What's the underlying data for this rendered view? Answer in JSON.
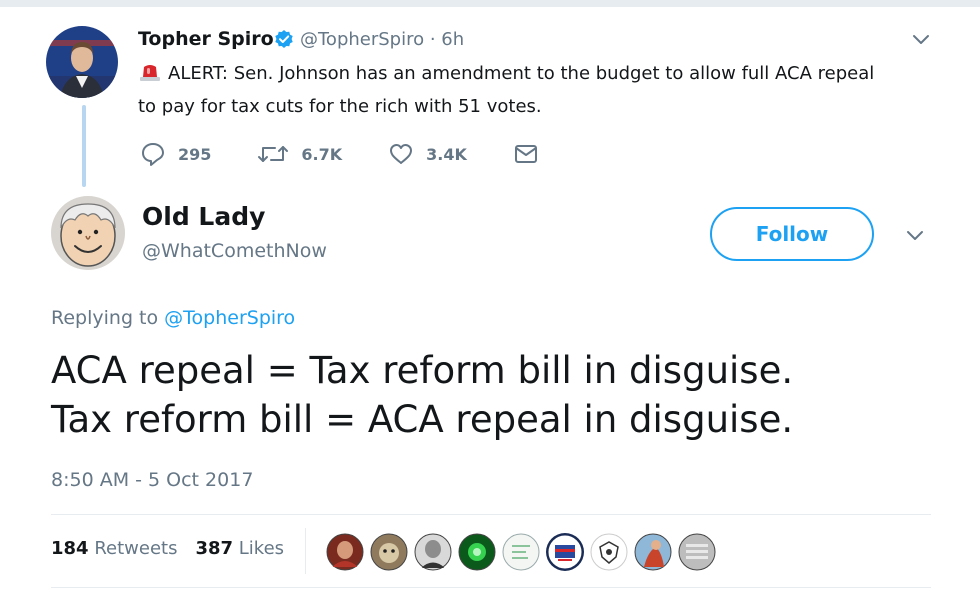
{
  "parent_tweet": {
    "author_name": "Topher Spiro",
    "verified_icon": "verified-badge-icon",
    "handle_time": "@TopherSpiro · 6h",
    "siren_icon": "siren-emoji-icon",
    "text_line1": "ALERT: Sen. Johnson has an amendment to the budget to allow full ACA repeal",
    "text_line2": "to pay for tax cuts for the rich with 51 votes.",
    "actions": {
      "replies": "295",
      "retweets": "6.7K",
      "likes": "3.4K"
    }
  },
  "reply_tweet": {
    "author_name": "Old Lady",
    "handle": "@WhatComethNow",
    "follow_label": "Follow",
    "replying_prefix": "Replying to ",
    "replying_handle": "@TopherSpiro",
    "text_line1": "ACA repeal = Tax reform bill in disguise.",
    "text_line2": "Tax reform bill = ACA repeal in disguise.",
    "timestamp": "8:50 AM - 5 Oct 2017",
    "retweet_count": "184",
    "retweet_label": "Retweets",
    "like_count": "387",
    "like_label": "Likes"
  },
  "colors": {
    "accent": "#1da1f2",
    "text_primary": "#14171a",
    "text_secondary": "#657786",
    "divider": "#e6ecf0",
    "thread_line": "#b8d6ef"
  }
}
